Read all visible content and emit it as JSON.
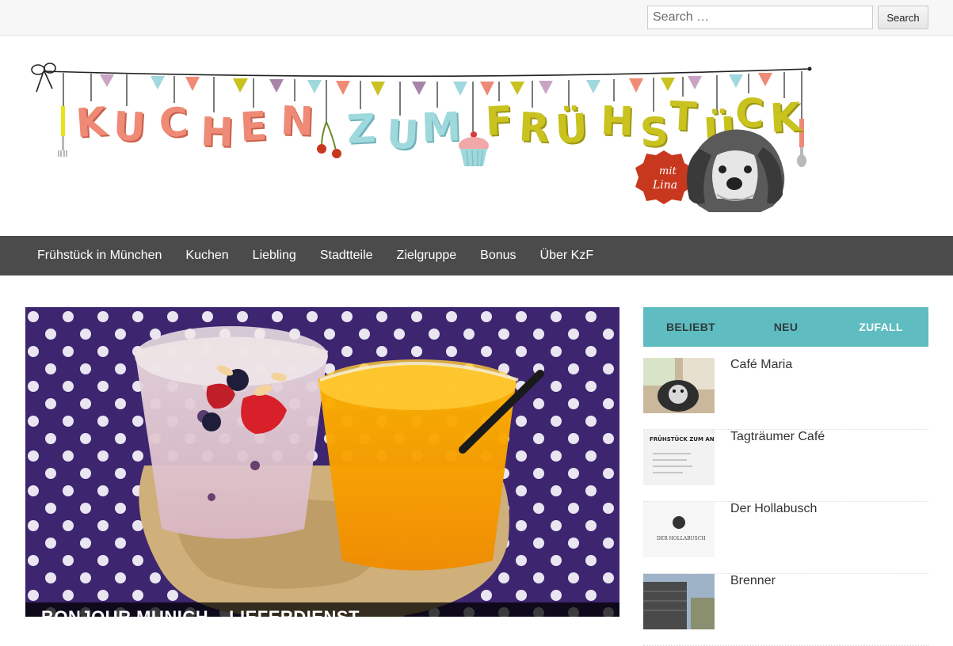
{
  "search": {
    "placeholder": "Search …",
    "button_label": "Search"
  },
  "banner": {
    "letters": {
      "kuchen": [
        "K",
        "U",
        "C",
        "H",
        "E",
        "N"
      ],
      "zum": [
        "Z",
        "U",
        "M"
      ],
      "fruehstueck": [
        "F",
        "R",
        "Ü",
        "H",
        "S",
        "T",
        "Ü",
        "C",
        "K"
      ]
    },
    "badge_line1": "mit",
    "badge_line2": "Lina"
  },
  "nav": {
    "items": [
      {
        "label": "Frühstück in München"
      },
      {
        "label": "Kuchen"
      },
      {
        "label": "Liebling"
      },
      {
        "label": "Stadtteile"
      },
      {
        "label": "Zielgruppe"
      },
      {
        "label": "Bonus"
      },
      {
        "label": "Über KzF"
      }
    ]
  },
  "hero": {
    "caption": "BONJOUR MUNICH – LIEFERDIENST"
  },
  "sidebar": {
    "tabs": [
      {
        "label": "BELIEBT"
      },
      {
        "label": "NEU"
      },
      {
        "label": "ZUFALL"
      }
    ],
    "posts": [
      {
        "title": "Café Maria"
      },
      {
        "title": "Tagträumer Café",
        "thumb_text": "FRÜHSTÜCK ZUM ANKREUZEN"
      },
      {
        "title": "Der Hollabusch",
        "thumb_text": "DER HOLLABUSCH"
      },
      {
        "title": "Brenner"
      }
    ]
  },
  "colors": {
    "nav_bg": "#4b4b4b",
    "tab_bg": "#5fbcc0",
    "coral": "#ef8a76",
    "light_blue": "#9fd8dd",
    "mustard": "#c9c21f"
  }
}
